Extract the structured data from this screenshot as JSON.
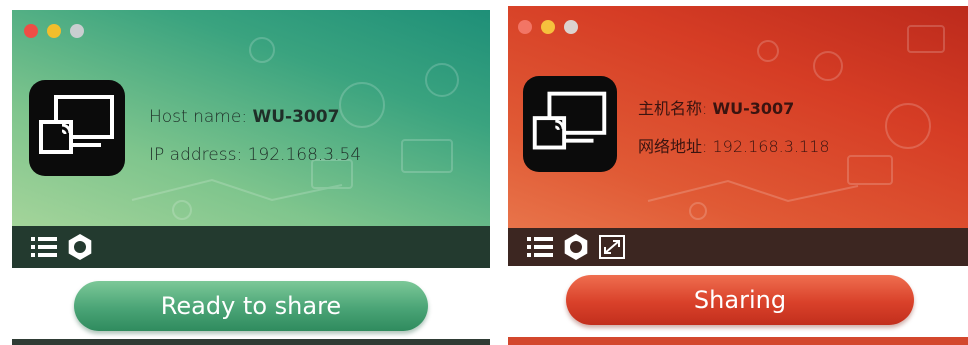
{
  "left_window": {
    "host_label": "Host name:",
    "host_value": "WU-3007",
    "ip_label": "IP address:",
    "ip_value": "192.168.3.54",
    "button_label": "Ready to share",
    "icons": [
      "list-icon",
      "gear-icon"
    ]
  },
  "right_window": {
    "host_label": "主机名称:",
    "host_value": "WU-3007",
    "ip_label": "网络地址:",
    "ip_value": "192.168.3.118",
    "button_label": "Sharing",
    "icons": [
      "list-icon",
      "gear-icon",
      "fullscreen-icon"
    ]
  },
  "colors": {
    "green_theme": "#3aa37f",
    "red_theme": "#d63d25",
    "toolbar_green": "#233a2f",
    "toolbar_red": "#3c2621"
  }
}
